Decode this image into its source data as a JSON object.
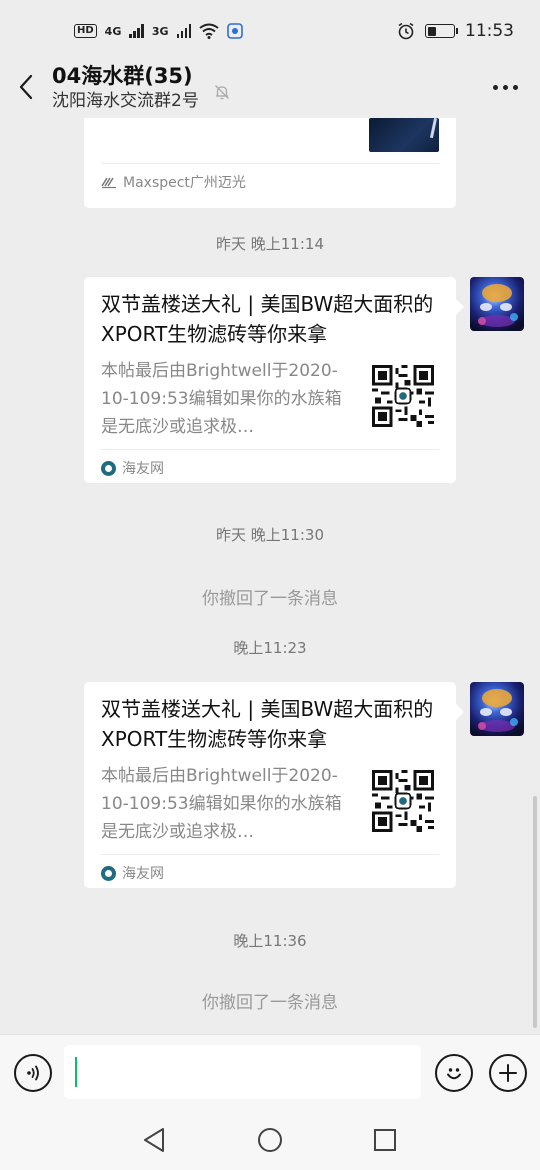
{
  "status": {
    "time": "11:53",
    "hd": "HD",
    "net1": "4G",
    "net2": "3G",
    "battery_level": 0.35
  },
  "header": {
    "title": "04海水群(35)",
    "subtitle": "沈阳海水交流群2号"
  },
  "messages": {
    "prev_source": "Maxspect广州迈光",
    "time1": "昨天 晚上11:14",
    "card1": {
      "title": "双节盖楼送大礼 | 美国BW超大面积的XPORT生物滤砖等你来拿",
      "desc": "本帖最后由Brightwell于2020-10-109:53编辑如果你的水族箱是无底沙或追求极…",
      "source": "海友网"
    },
    "time2": "昨天 晚上11:30",
    "recall1": "你撤回了一条消息",
    "time3": "晚上11:23",
    "card2": {
      "title": "双节盖楼送大礼 | 美国BW超大面积的XPORT生物滤砖等你来拿",
      "desc": "本帖最后由Brightwell于2020-10-109:53编辑如果你的水族箱是无底沙或追求极…",
      "source": "海友网"
    },
    "time4": "晚上11:36",
    "recall2": "你撤回了一条消息"
  },
  "colors": {
    "background": "#ededed",
    "caret": "#07c160",
    "source_icon": "#1e6b82"
  }
}
